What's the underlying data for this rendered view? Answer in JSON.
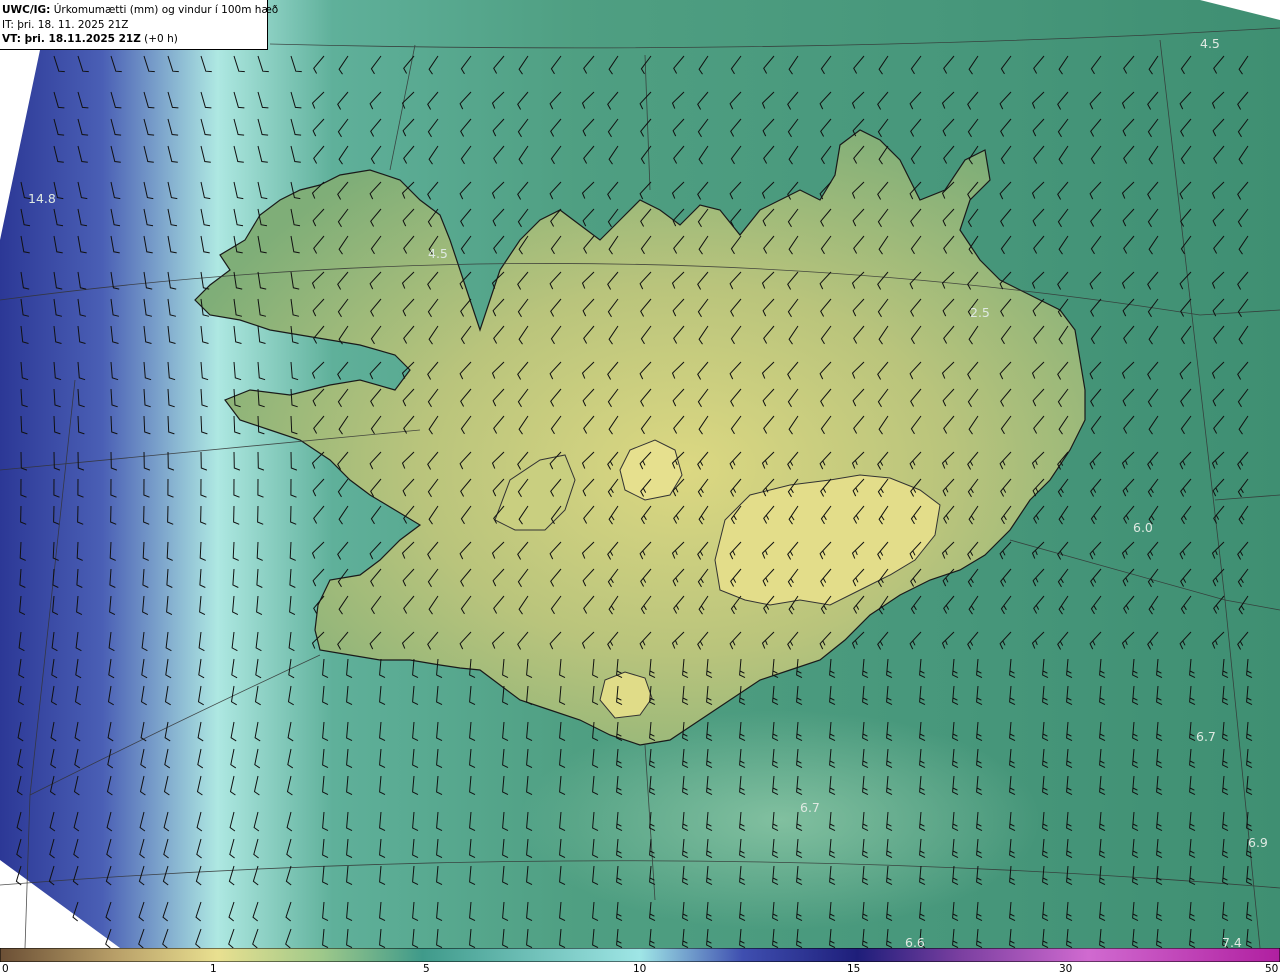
{
  "header": {
    "line1_prefix": "UWC/IG:",
    "line1_text": " Úrkomumætti (mm) og vindur í 100m hæð",
    "line2": "IT: þri. 18. 11. 2025 21Z",
    "line3_prefix": "VT: þri. 18.11.2025 21Z",
    "line3_suffix": " (+0 h)"
  },
  "map_values": [
    {
      "label": "14.8"
    },
    {
      "label": "4.5"
    },
    {
      "label": "4.5"
    },
    {
      "label": "2.5"
    },
    {
      "label": "6.0"
    },
    {
      "label": "6.7"
    },
    {
      "label": "6.7"
    },
    {
      "label": "6.9"
    },
    {
      "label": "6.6"
    },
    {
      "label": "7.4"
    }
  ],
  "colorbar": {
    "ticks": [
      "0",
      "1",
      "5",
      "10",
      "15",
      "30",
      "50"
    ],
    "colors": [
      "#6b4f35",
      "#b89f68",
      "#e9e090",
      "#9fc98a",
      "#3f9a8a",
      "#9fe6e6",
      "#3f4fb0",
      "#1e1e7a",
      "#7a3fa0",
      "#d06ad0",
      "#b01fa0"
    ]
  },
  "colors": {
    "land_high": "#d9d67f",
    "land_mid": "#a8bf78",
    "sea_green": "#3f8f72",
    "sea_teal": "#5fb09a",
    "sea_cyan": "#aee8e2",
    "sea_blue": "#4a5fb5",
    "sea_navy": "#2c3896"
  }
}
